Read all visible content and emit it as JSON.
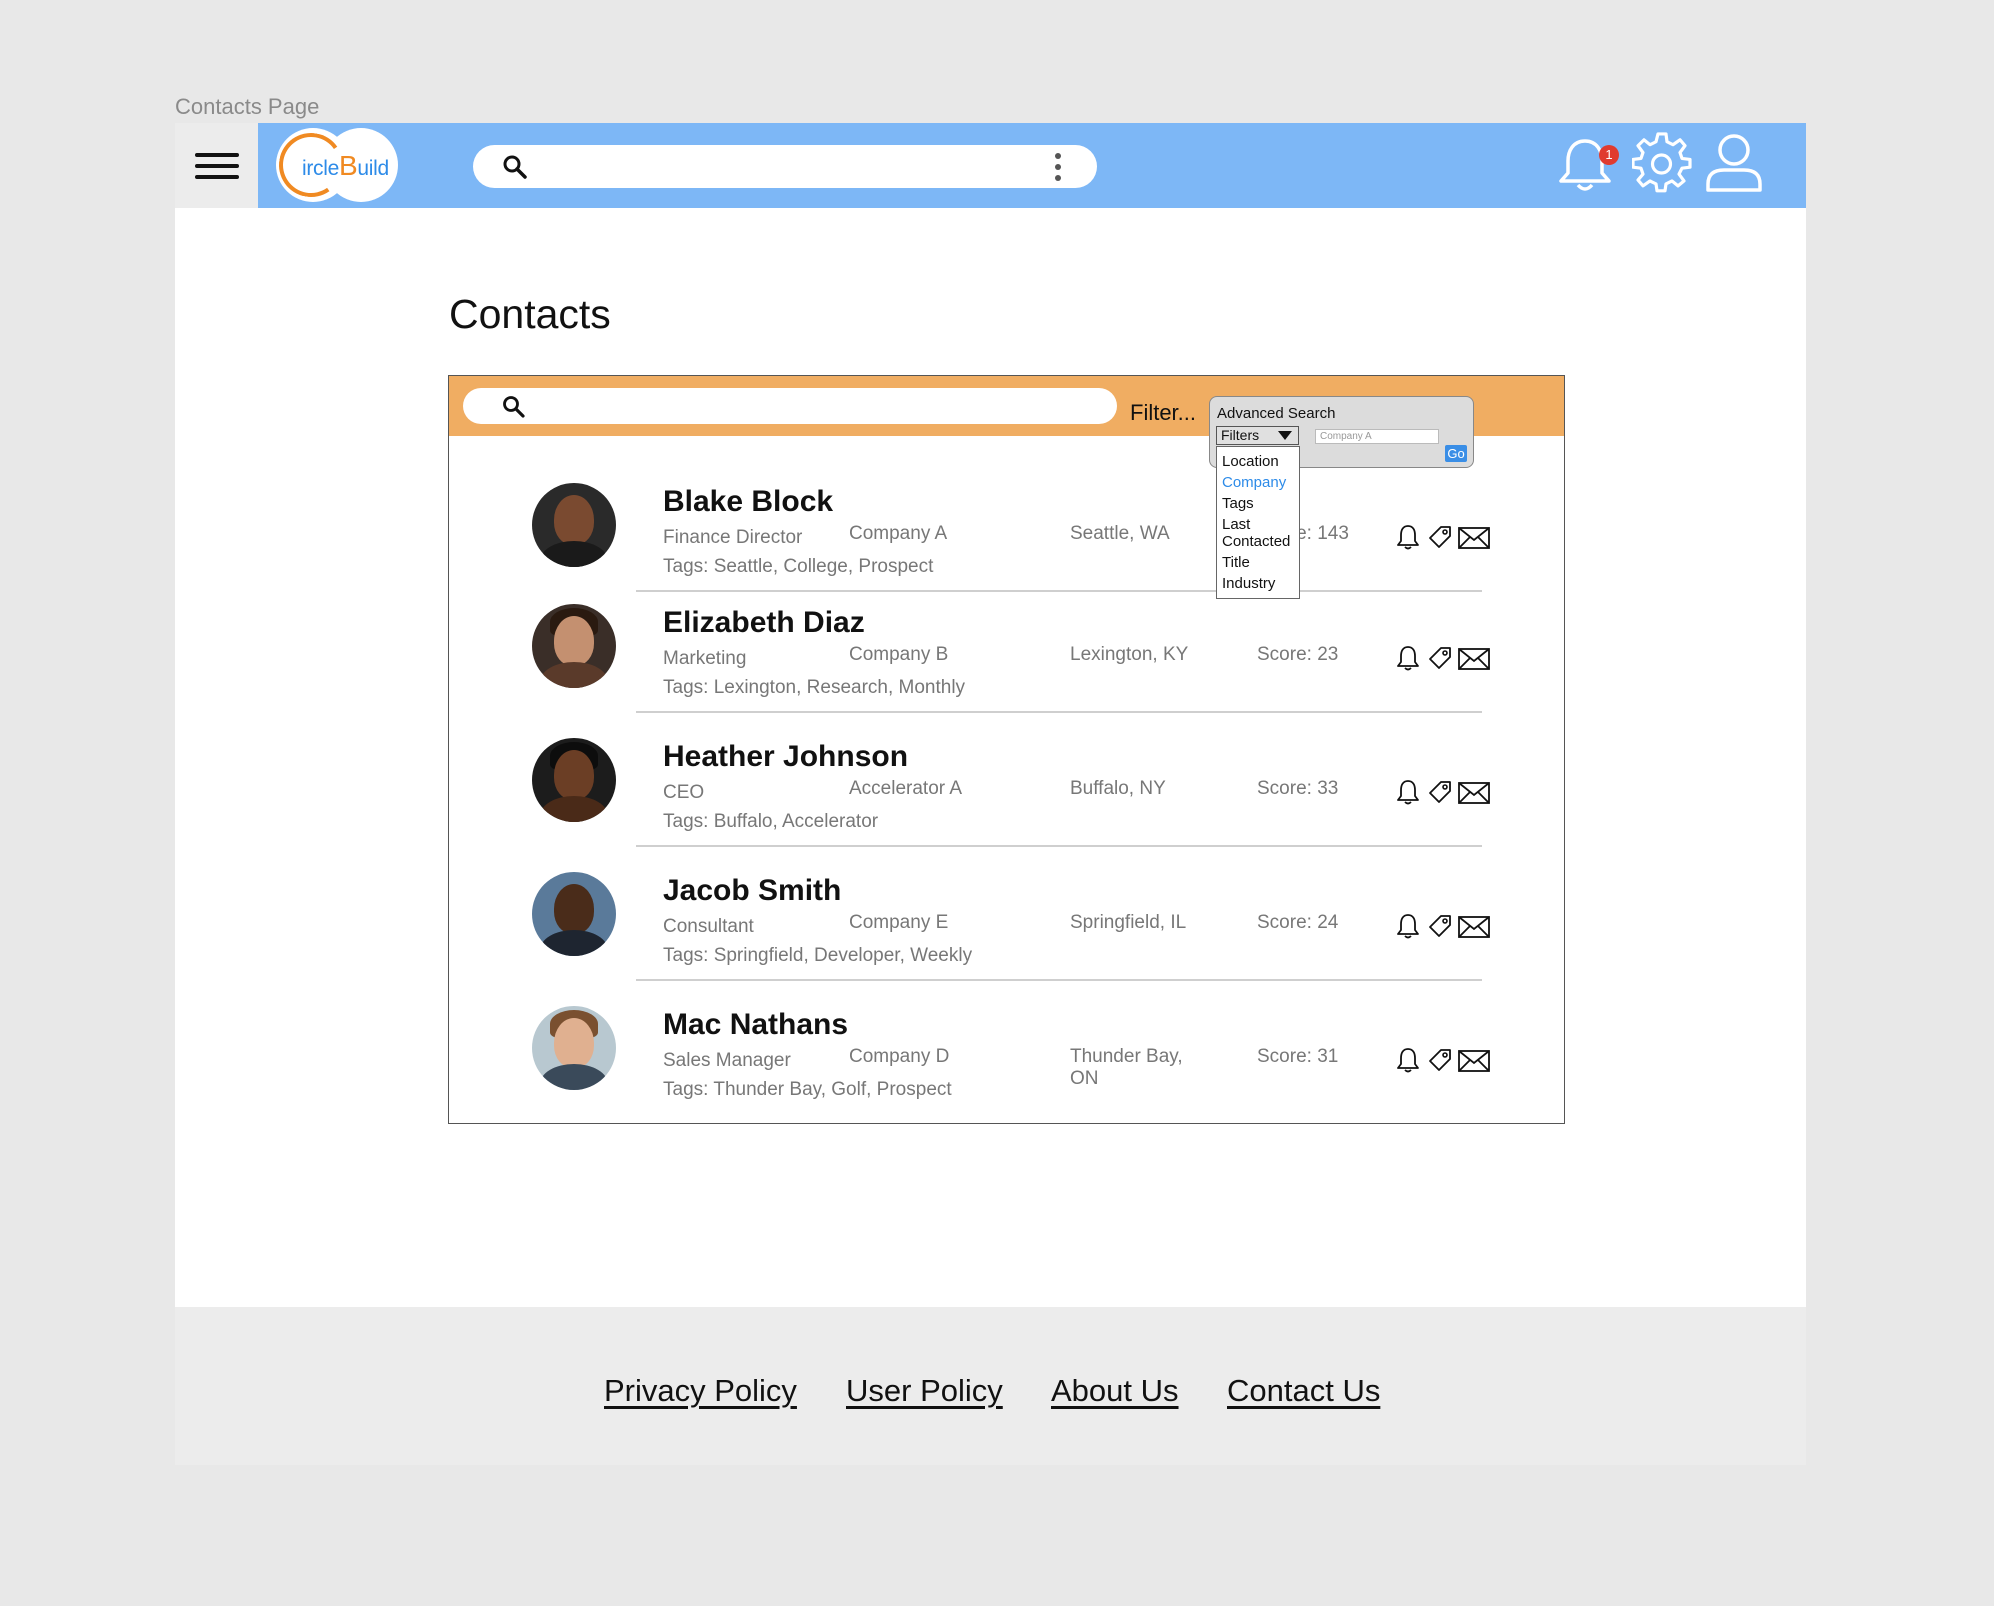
{
  "page_label": "Contacts Page",
  "header": {
    "logo": {
      "initial_c": "C",
      "part1": "ircle",
      "initial_b": "B",
      "part2": "uild"
    },
    "notification_count": "1"
  },
  "title": "Contacts",
  "toolbar": {
    "filter_label": "Filter..."
  },
  "advanced_search": {
    "title": "Advanced Search",
    "select_value": "Filters",
    "input_value": "Company A",
    "go_label": "Go",
    "options": [
      "Location",
      "Company",
      "Tags",
      "Last Contacted",
      "Title",
      "Industry"
    ]
  },
  "contacts": [
    {
      "name": "Blake Block",
      "role": "Finance Director",
      "company": "Company A",
      "location": "Seattle, WA",
      "score": "Score: 143",
      "tags": "Tags: Seattle, College, Prospect"
    },
    {
      "name": "Elizabeth Diaz",
      "role": "Marketing",
      "company": "Company B",
      "location": "Lexington, KY",
      "score": "Score: 23",
      "tags": "Tags: Lexington, Research, Monthly"
    },
    {
      "name": "Heather Johnson",
      "role": "CEO",
      "company": "Accelerator A",
      "location": "Buffalo, NY",
      "score": "Score: 33",
      "tags": "Tags: Buffalo, Accelerator"
    },
    {
      "name": "Jacob Smith",
      "role": "Consultant",
      "company": "Company E",
      "location": "Springfield, IL",
      "score": "Score: 24",
      "tags": "Tags: Springfield, Developer, Weekly"
    },
    {
      "name": "Mac Nathans",
      "role": "Sales Manager",
      "company": "Company D",
      "location": "Thunder Bay, ON",
      "score": "Score: 31",
      "tags": "Tags: Thunder Bay, Golf, Prospect"
    }
  ],
  "footer": {
    "links": [
      "Privacy Policy",
      "User Policy",
      "About Us",
      "Contact Us"
    ]
  },
  "colors": {
    "header_blue": "#7db7f6",
    "toolbar_orange": "#f0ad62",
    "logo_orange": "#f08a22",
    "logo_blue": "#2d8be8",
    "badge_red": "#e03b2f"
  }
}
